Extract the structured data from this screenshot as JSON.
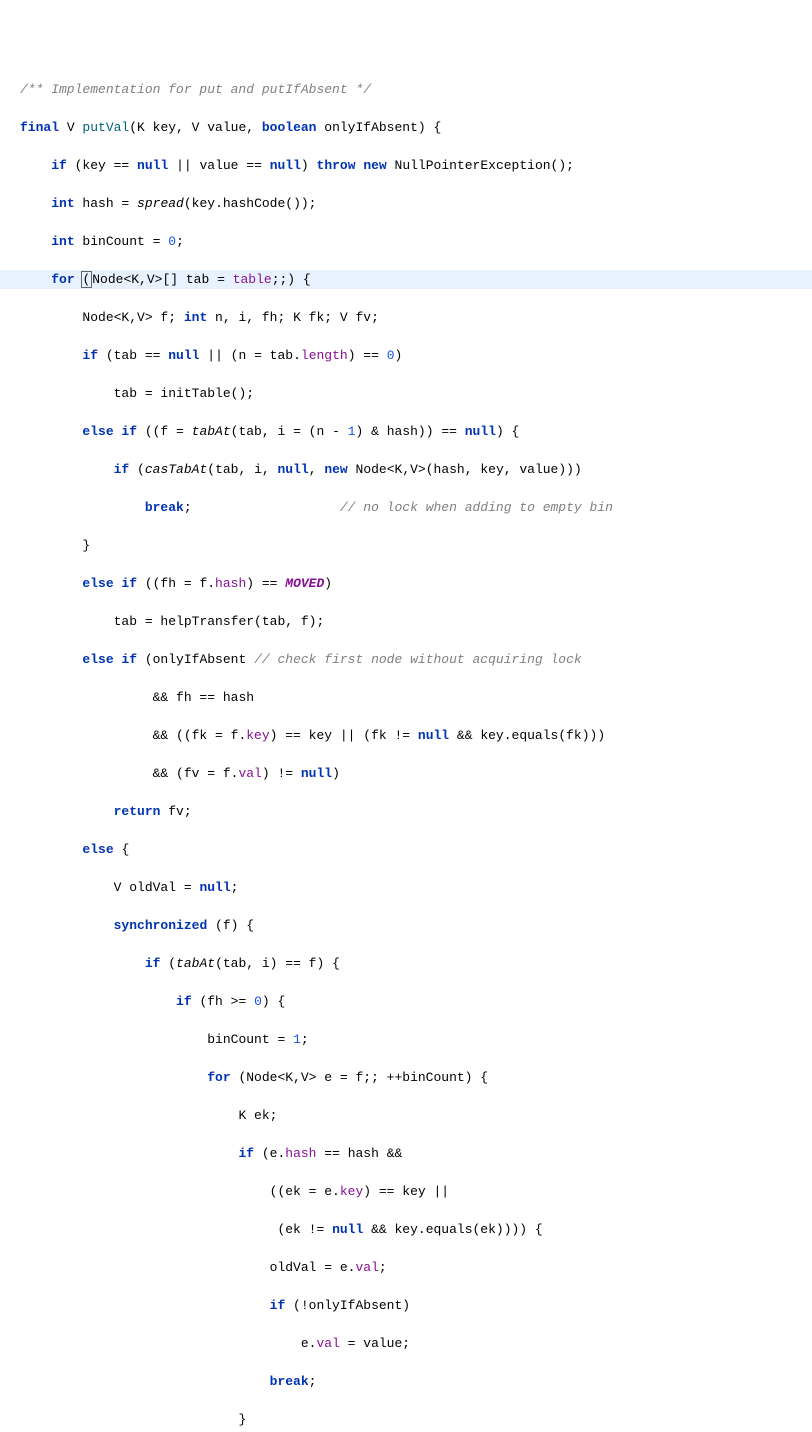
{
  "code": {
    "l01": "/** Implementation for put and putIfAbsent */",
    "l02_kw1": "final",
    "l02_t1": " V ",
    "l02_m": "putVal",
    "l02_rest1": "(K key, V value, ",
    "l02_kw2": "boolean",
    "l02_rest2": " onlyIfAbsent) {",
    "l03_kw1": "if",
    "l03_a": " (key == ",
    "l03_kw2": "null",
    "l03_b": " || value == ",
    "l03_kw3": "null",
    "l03_c": ") ",
    "l03_kw4": "throw new",
    "l03_d": " NullPointerException();",
    "l04_kw1": "int",
    "l04_a": " hash = ",
    "l04_call": "spread",
    "l04_b": "(key.hashCode());",
    "l05_kw1": "int",
    "l05_a": " binCount = ",
    "l05_num": "0",
    "l05_b": ";",
    "l06_kw1": "for",
    "l06_a": " ",
    "l06_caret": "(",
    "l06_b": "Node<K,V>[] tab = ",
    "l06_field": "table",
    "l06_c": ";;) {",
    "l07_a": "Node<K,V> f; ",
    "l07_kw1": "int",
    "l07_b": " n, i, fh; K fk; V fv;",
    "l08_kw1": "if",
    "l08_a": " (tab == ",
    "l08_kw2": "null",
    "l08_b": " || (n = tab.",
    "l08_field": "length",
    "l08_c": ") == ",
    "l08_num": "0",
    "l08_d": ")",
    "l09_a": "tab = initTable();",
    "l10_kw1": "else if",
    "l10_a": " ((f = ",
    "l10_call": "tabAt",
    "l10_b": "(tab, i = (n - ",
    "l10_num": "1",
    "l10_c": ") & hash)) == ",
    "l10_kw2": "null",
    "l10_d": ") {",
    "l11_kw1": "if",
    "l11_a": " (",
    "l11_call": "casTabAt",
    "l11_b": "(tab, i, ",
    "l11_kw2": "null",
    "l11_c": ", ",
    "l11_kw3": "new",
    "l11_d": " Node<K,V>(hash, key, value)))",
    "l12_kw1": "break",
    "l12_a": ";                   ",
    "l12_comment": "// no lock when adding to empty bin",
    "l13_a": "}",
    "l14_kw1": "else if",
    "l14_a": " ((fh = f.",
    "l14_field": "hash",
    "l14_b": ") == ",
    "l14_const": "MOVED",
    "l14_c": ")",
    "l15_a": "tab = helpTransfer(tab, f);",
    "l16_kw1": "else if",
    "l16_a": " (onlyIfAbsent ",
    "l16_comment": "// check first node without acquiring lock",
    "l17_a": "&& fh == hash",
    "l18_a": "&& ((fk = f.",
    "l18_field": "key",
    "l18_b": ") == key || (fk != ",
    "l18_kw1": "null",
    "l18_c": " && key.equals(fk)))",
    "l19_a": "&& (fv = f.",
    "l19_field": "val",
    "l19_b": ") != ",
    "l19_kw1": "null",
    "l19_c": ")",
    "l20_kw1": "return",
    "l20_a": " fv;",
    "l21_kw1": "else",
    "l21_a": " {",
    "l22_a": "V oldVal = ",
    "l22_kw1": "null",
    "l22_b": ";",
    "l23_kw1": "synchronized",
    "l23_a": " (f) {",
    "l24_kw1": "if",
    "l24_a": " (",
    "l24_call": "tabAt",
    "l24_b": "(tab, i) == f) {",
    "l25_kw1": "if",
    "l25_a": " (fh >= ",
    "l25_num": "0",
    "l25_b": ") {",
    "l26_a": "binCount = ",
    "l26_num": "1",
    "l26_b": ";",
    "l27_kw1": "for",
    "l27_a": " (Node<K,V> e = f;; ++binCount) {",
    "l28_a": "K ek;",
    "l29_kw1": "if",
    "l29_a": " (e.",
    "l29_field": "hash",
    "l29_b": " == hash &&",
    "l30_a": "((ek = e.",
    "l30_field": "key",
    "l30_b": ") == key ||",
    "l31_a": " (ek != ",
    "l31_kw1": "null",
    "l31_b": " && key.equals(ek)))) {",
    "l32_a": "oldVal = e.",
    "l32_field": "val",
    "l32_b": ";",
    "l33_kw1": "if",
    "l33_a": " (!onlyIfAbsent)",
    "l34_a": "e.",
    "l34_field": "val",
    "l34_b": " = value;",
    "l35_kw1": "break",
    "l35_a": ";",
    "l36_a": "}"
  }
}
